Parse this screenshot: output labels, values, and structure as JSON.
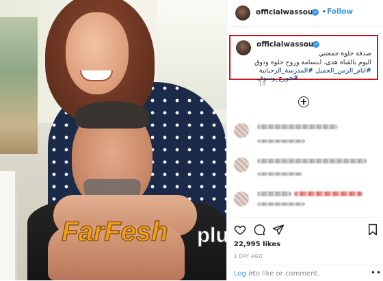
{
  "post": {
    "username": "officialwassouf",
    "follow_label": "Follow",
    "separator": "•",
    "verified_mark": "✓",
    "caption_lines": [
      "صدفة حلوة جمعتني",
      "اليوم بالقناة هدى، ابتسامة وروح حلوة وذوق",
      "#ايام_الزمن_الجميل #المدرسة_الرحبانية",
      "#جورج_وسوف"
    ],
    "caption_time": "1d",
    "likes": "22,995 likes",
    "posted_time": "1 DAY AGO",
    "login_link": "Log in",
    "login_rest": "to like or comment.",
    "more_label": "•••"
  },
  "watermark": {
    "part1": "FarFesh",
    "part2": "plus.com",
    "colors": {
      "part1": "#f2a01c",
      "part2": "#ffffff"
    }
  },
  "icons": {
    "verified": "verified-badge-icon",
    "add": "plus-circle-icon",
    "like": "heart-icon",
    "comment": "comment-bubble-icon",
    "share": "paper-plane-icon",
    "save": "bookmark-icon",
    "more": "more-options-icon"
  },
  "colors": {
    "accent": "#3897f0",
    "highlight_box": "#d0131b",
    "hashtag": "#003569"
  }
}
